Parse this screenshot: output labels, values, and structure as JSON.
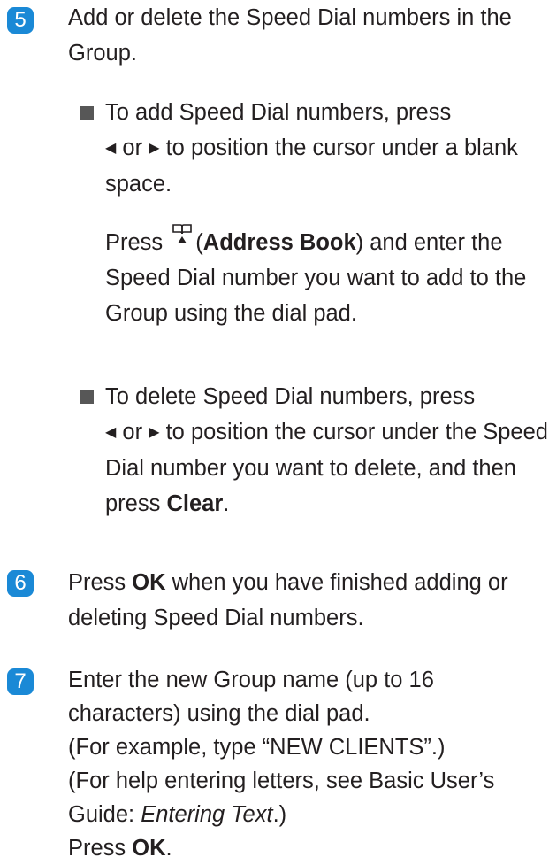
{
  "steps": {
    "s5": {
      "num": "5",
      "text": "Add or delete the Speed Dial numbers in the Group.",
      "bullet1": {
        "a": "To add Speed Dial numbers, press",
        "or": "or",
        "b": "to position the cursor under a blank space.",
        "press": "Press",
        "key": "Address Book",
        "c": "and enter the Speed Dial number you want to add to the Group using the dial pad."
      },
      "bullet2": {
        "a": "To delete Speed Dial numbers, press",
        "or": "or",
        "b": "to position the cursor under the Speed Dial number you want to delete, and then press",
        "key": "Clear"
      }
    },
    "s6": {
      "num": "6",
      "press": "Press",
      "key": "OK",
      "text": "when you have finished adding or deleting Speed Dial numbers."
    },
    "s7": {
      "num": "7",
      "line1": "Enter the new Group name (up to 16 characters) using the dial pad.",
      "line2": "(For example, type “NEW CLIENTS”.)",
      "line3a": "(For help entering letters, see Basic User’s Guide:",
      "line3ref": "Entering Text",
      "line3b": ".)",
      "press": "Press",
      "key": "OK"
    }
  },
  "icons": {
    "badge_color": "#1a89d6",
    "bullet": "square-bullet-icon",
    "left": "left-arrow-icon",
    "right": "right-arrow-icon",
    "book": "address-book-icon"
  }
}
